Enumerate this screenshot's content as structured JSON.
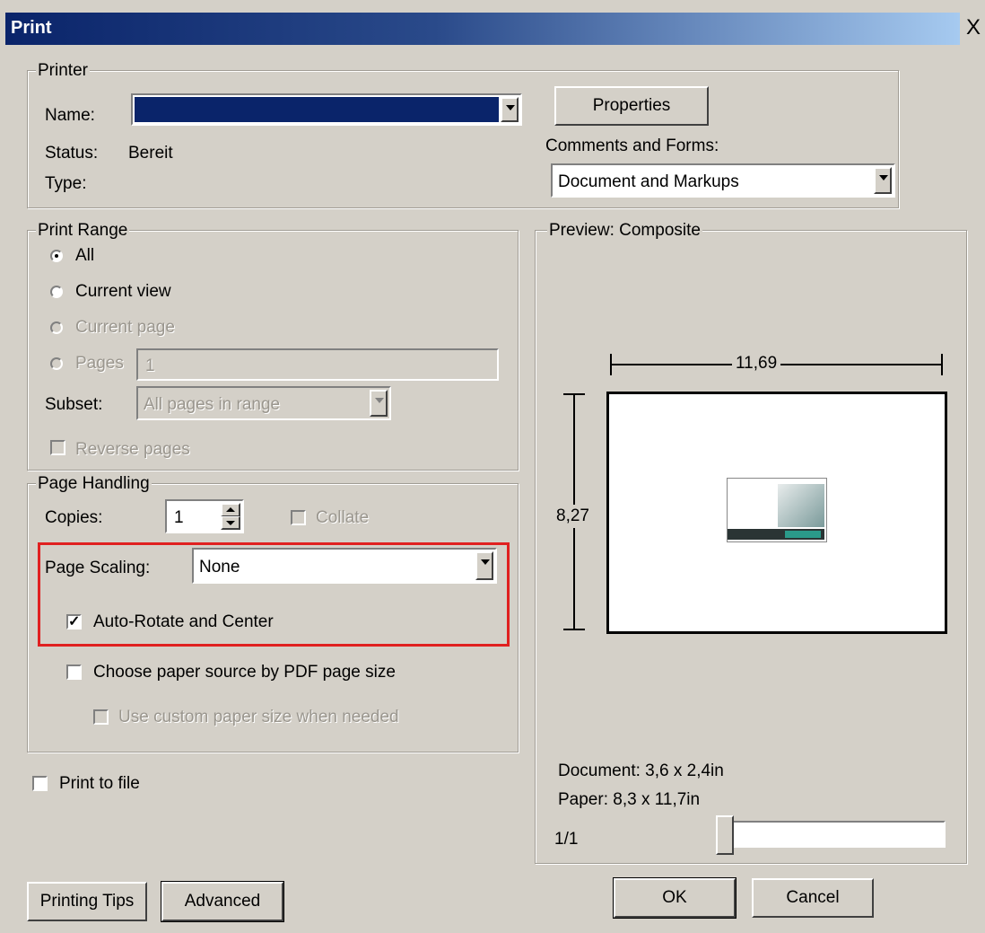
{
  "window": {
    "title": "Print",
    "close_glyph": "X"
  },
  "printer": {
    "group_label": "Printer",
    "name_label": "Name:",
    "name_value": "",
    "status_label": "Status:",
    "status_value": "Bereit",
    "type_label": "Type:",
    "type_value": "",
    "properties_button": "Properties",
    "comments_label": "Comments and Forms:",
    "comments_value": "Document and Markups"
  },
  "print_range": {
    "group_label": "Print Range",
    "all_label": "All",
    "current_view_label": "Current view",
    "current_page_label": "Current page",
    "pages_label": "Pages",
    "pages_value": "1",
    "subset_label": "Subset:",
    "subset_value": "All pages in range",
    "reverse_label": "Reverse pages",
    "selected": "All"
  },
  "page_handling": {
    "group_label": "Page Handling",
    "copies_label": "Copies:",
    "copies_value": "1",
    "collate_label": "Collate",
    "scaling_label": "Page Scaling:",
    "scaling_value": "None",
    "auto_rotate_label": "Auto-Rotate and Center",
    "auto_rotate_checked": true,
    "paper_source_label": "Choose paper source by PDF page size",
    "paper_source_checked": false,
    "custom_paper_label": "Use custom paper size when needed"
  },
  "print_to_file": {
    "label": "Print to file",
    "checked": false
  },
  "preview": {
    "group_label": "Preview: Composite",
    "width_value": "11,69",
    "height_value": "8,27",
    "document_size": "Document: 3,6 x 2,4in",
    "paper_size": "Paper: 8,3 x 11,7in",
    "page_counter": "1/1"
  },
  "buttons": {
    "printing_tips": "Printing Tips",
    "advanced": "Advanced",
    "ok": "OK",
    "cancel": "Cancel"
  },
  "colors": {
    "title_bar": "#0a246a",
    "highlight_box": "#e02020",
    "selection": "#0a246a"
  }
}
